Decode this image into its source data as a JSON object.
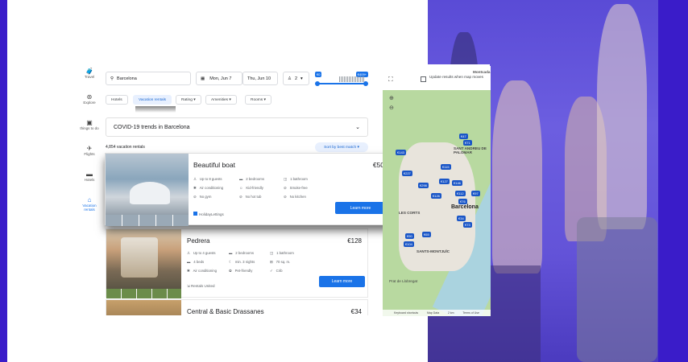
{
  "nav": {
    "travel": "Travel",
    "explore": "Explore",
    "things": "things to do",
    "flights": "Flights",
    "hotels": "Hotels",
    "vacation": "Vacation rentals"
  },
  "search": {
    "location": "Barcelona",
    "checkin": "Mon, Jun 7",
    "checkout": "Thu, Jun 10",
    "guests": "2",
    "price_min": "€0",
    "price_max": "€409+"
  },
  "filters": {
    "hotels": "Hotels",
    "vacation": "Vacation rentals",
    "rating": "Rating",
    "amenities": "Amenities",
    "rooms": "Rooms"
  },
  "covid": "COVID-19 trends in Barcelona",
  "results": {
    "count": "4,854 vacation rentals",
    "sort": "Sort by best match"
  },
  "map": {
    "update": "Update results when map moves",
    "labels": {
      "montcada": "Montcada",
      "santandreu": "SANT ANDREU DE PALOMAR",
      "barcelona": "Barcelona",
      "lescorts": "LES CORTS",
      "santsmontjuic": "SANTS-MONTJUÏC",
      "prat": "Prat de Llobregat",
      "keyboard": "Keyboard shortcuts",
      "mapdata": "Map Data",
      "km": "2 km",
      "terms": "Terms of Use"
    },
    "prices": [
      "€47",
      "€71",
      "€143",
      "€227",
      "€115",
      "€127",
      "€146",
      "€298",
      "€126",
      "€112",
      "€97",
      "€76",
      "€34",
      "€73",
      "€90",
      "€104",
      "€65"
    ]
  },
  "listings": [
    {
      "title": "Beautiful boat",
      "price": "€50",
      "amenities": [
        "Up to 8 guests",
        "2 bedrooms",
        "1 bathroom",
        "Air conditioning",
        "Kid-friendly",
        "Smoke-free",
        "No gym",
        "No hot tub",
        "No kitchen"
      ],
      "provider": "HolidayLettings",
      "cta": "Learn more"
    },
    {
      "title": "Pedrera",
      "price": "€128",
      "amenities": [
        "Up to 4 guests",
        "2 bedrooms",
        "1 bathroom",
        "4 beds",
        "min. 3 nights",
        "70 sq. m.",
        "Air conditioning",
        "Pet-friendly",
        "Crib"
      ],
      "provider": "Rentals United",
      "cta": "Learn more"
    },
    {
      "title": "Central & Basic Drassanes",
      "price": "€34"
    }
  ]
}
